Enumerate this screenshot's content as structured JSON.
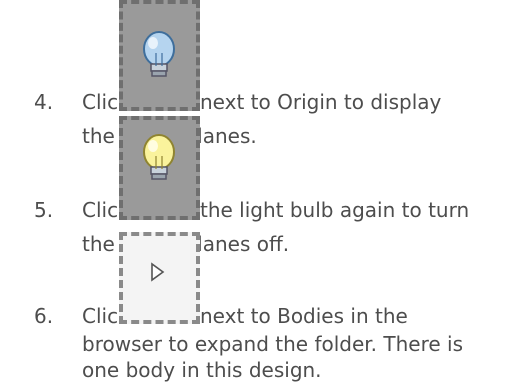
{
  "steps": [
    {
      "number": "4.",
      "before": "Click",
      "after": "next to Origin to display",
      "line2": "the origin planes.",
      "icon": "lightbulb-off-icon",
      "icon_color": "#9fc4e8"
    },
    {
      "number": "5.",
      "before": "Click",
      "after": "the light bulb again to turn",
      "line2": "the origin planes off.",
      "icon": "lightbulb-on-icon",
      "icon_color": "#f6ef8e"
    },
    {
      "number": "6.",
      "before": "Click",
      "after": "next to Bodies in the",
      "line2": "browser to expand the folder. There is",
      "line3": "one body in this design.",
      "icon": "expand-triangle-icon",
      "icon_color": "#ffffff"
    }
  ]
}
